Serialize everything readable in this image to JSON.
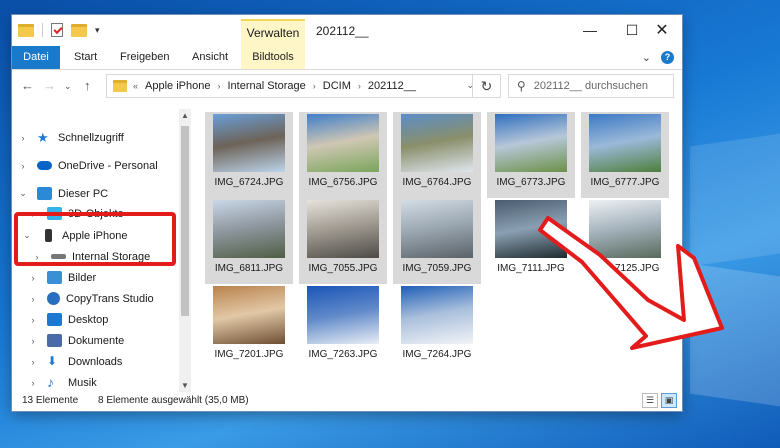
{
  "window": {
    "title": "202112__",
    "context_tab": "Verwalten",
    "controls": {
      "minimize": "—",
      "maximize": "☐",
      "close": "✕"
    }
  },
  "ribbon": {
    "tabs": [
      "Datei",
      "Start",
      "Freigeben",
      "Ansicht",
      "Bildtools"
    ],
    "collapse": "⌄",
    "help": "?"
  },
  "address": {
    "prefix": "«",
    "breadcrumbs": [
      "Apple iPhone",
      "Internal Storage",
      "DCIM",
      "202112__"
    ],
    "search_placeholder": "202112__ durchsuchen"
  },
  "nav": {
    "items": [
      {
        "label": "Schnellzugriff",
        "icon": "star-icon",
        "chevron": "›",
        "color": "#1e78d2"
      },
      {
        "label": "OneDrive - Personal",
        "icon": "cloud-icon",
        "chevron": "›",
        "color": "#0a64c8"
      },
      {
        "label": "Dieser PC",
        "icon": "pc-icon",
        "chevron": "⌄",
        "color": "#2b8ad8"
      },
      {
        "label": "3D-Objekte",
        "icon": "cube-icon",
        "chevron": "›",
        "color": "#35b3e8"
      },
      {
        "label": "Apple iPhone",
        "icon": "phone-icon",
        "chevron": "⌄",
        "color": "#333333"
      },
      {
        "label": "Internal Storage",
        "icon": "drive-icon",
        "chevron": "›",
        "color": "#777777"
      },
      {
        "label": "Bilder",
        "icon": "pictures-icon",
        "chevron": "›",
        "color": "#3b8fd6"
      },
      {
        "label": "CopyTrans Studio",
        "icon": "copytrans-icon",
        "chevron": "›",
        "color": "#2a6fbf"
      },
      {
        "label": "Desktop",
        "icon": "desktop-icon",
        "chevron": "›",
        "color": "#1e78d2"
      },
      {
        "label": "Dokumente",
        "icon": "documents-icon",
        "chevron": "›",
        "color": "#4b6aa8"
      },
      {
        "label": "Downloads",
        "icon": "download-icon",
        "chevron": "›",
        "color": "#1e78d2"
      },
      {
        "label": "Musik",
        "icon": "music-icon",
        "chevron": "›",
        "color": "#1e78d2"
      }
    ]
  },
  "files": [
    {
      "name": "IMG_6724.JPG",
      "selected": true,
      "colors": [
        "#6a9fd8",
        "#bcd4ea",
        "#6d6358"
      ]
    },
    {
      "name": "IMG_6756.JPG",
      "selected": true,
      "colors": [
        "#3f7ec9",
        "#7aa55a",
        "#cfc7b4"
      ]
    },
    {
      "name": "IMG_6764.JPG",
      "selected": true,
      "colors": [
        "#5b8ec7",
        "#dfe6ee",
        "#8a8f6a"
      ]
    },
    {
      "name": "IMG_6773.JPG",
      "selected": true,
      "colors": [
        "#2f6fc0",
        "#6c9148",
        "#b7c7d8"
      ]
    },
    {
      "name": "IMG_6777.JPG",
      "selected": true,
      "colors": [
        "#3b79c4",
        "#4e7f3c",
        "#9bb9d9"
      ]
    },
    {
      "name": "IMG_6811.JPG",
      "selected": true,
      "colors": [
        "#c9d8e8",
        "#4f5e44",
        "#8e969e"
      ]
    },
    {
      "name": "IMG_7055.JPG",
      "selected": true,
      "colors": [
        "#e7e3dc",
        "#4d4a46",
        "#a09a91"
      ]
    },
    {
      "name": "IMG_7059.JPG",
      "selected": true,
      "colors": [
        "#d3dde6",
        "#5a6268",
        "#9aa6b0"
      ]
    },
    {
      "name": "IMG_7111.JPG",
      "selected": false,
      "colors": [
        "#4a5b6e",
        "#1f2b2f",
        "#8aa0b2"
      ]
    },
    {
      "name": "IMG_7125.JPG",
      "selected": false,
      "colors": [
        "#eef1f4",
        "#586a5c",
        "#a4b2bc"
      ]
    },
    {
      "name": "IMG_7201.JPG",
      "selected": false,
      "colors": [
        "#b9824d",
        "#6e4e33",
        "#e2c8a6"
      ]
    },
    {
      "name": "IMG_7263.JPG",
      "selected": false,
      "colors": [
        "#1a55b8",
        "#e9eef5",
        "#5f89c9"
      ]
    },
    {
      "name": "IMG_7264.JPG",
      "selected": false,
      "colors": [
        "#1f5fb8",
        "#f2f4f7",
        "#a9bfdc"
      ]
    }
  ],
  "status": {
    "item_count": "13 Elemente",
    "selection": "8 Elemente ausgewählt (35,0 MB)"
  },
  "colors": {
    "accent": "#1979ca",
    "annotation_red": "#e31b1b",
    "selection_bg": "#d9d9d9"
  }
}
